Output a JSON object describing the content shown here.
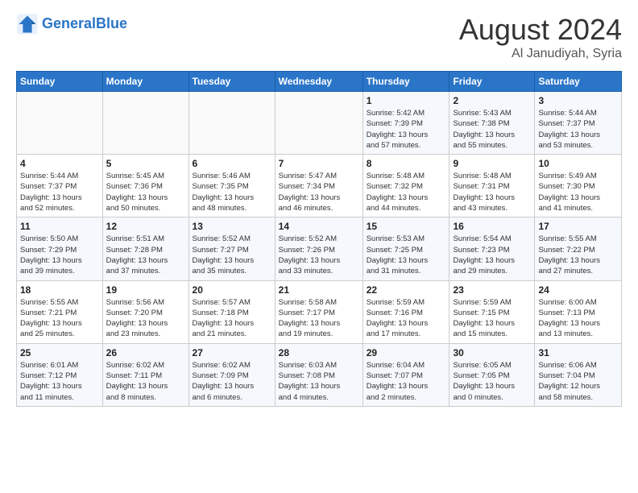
{
  "header": {
    "logo_line1": "General",
    "logo_line2": "Blue",
    "month": "August 2024",
    "location": "Al Janudiyah, Syria"
  },
  "weekdays": [
    "Sunday",
    "Monday",
    "Tuesday",
    "Wednesday",
    "Thursday",
    "Friday",
    "Saturday"
  ],
  "weeks": [
    [
      {
        "day": "",
        "info": ""
      },
      {
        "day": "",
        "info": ""
      },
      {
        "day": "",
        "info": ""
      },
      {
        "day": "",
        "info": ""
      },
      {
        "day": "1",
        "info": "Sunrise: 5:42 AM\nSunset: 7:39 PM\nDaylight: 13 hours\nand 57 minutes."
      },
      {
        "day": "2",
        "info": "Sunrise: 5:43 AM\nSunset: 7:38 PM\nDaylight: 13 hours\nand 55 minutes."
      },
      {
        "day": "3",
        "info": "Sunrise: 5:44 AM\nSunset: 7:37 PM\nDaylight: 13 hours\nand 53 minutes."
      }
    ],
    [
      {
        "day": "4",
        "info": "Sunrise: 5:44 AM\nSunset: 7:37 PM\nDaylight: 13 hours\nand 52 minutes."
      },
      {
        "day": "5",
        "info": "Sunrise: 5:45 AM\nSunset: 7:36 PM\nDaylight: 13 hours\nand 50 minutes."
      },
      {
        "day": "6",
        "info": "Sunrise: 5:46 AM\nSunset: 7:35 PM\nDaylight: 13 hours\nand 48 minutes."
      },
      {
        "day": "7",
        "info": "Sunrise: 5:47 AM\nSunset: 7:34 PM\nDaylight: 13 hours\nand 46 minutes."
      },
      {
        "day": "8",
        "info": "Sunrise: 5:48 AM\nSunset: 7:32 PM\nDaylight: 13 hours\nand 44 minutes."
      },
      {
        "day": "9",
        "info": "Sunrise: 5:48 AM\nSunset: 7:31 PM\nDaylight: 13 hours\nand 43 minutes."
      },
      {
        "day": "10",
        "info": "Sunrise: 5:49 AM\nSunset: 7:30 PM\nDaylight: 13 hours\nand 41 minutes."
      }
    ],
    [
      {
        "day": "11",
        "info": "Sunrise: 5:50 AM\nSunset: 7:29 PM\nDaylight: 13 hours\nand 39 minutes."
      },
      {
        "day": "12",
        "info": "Sunrise: 5:51 AM\nSunset: 7:28 PM\nDaylight: 13 hours\nand 37 minutes."
      },
      {
        "day": "13",
        "info": "Sunrise: 5:52 AM\nSunset: 7:27 PM\nDaylight: 13 hours\nand 35 minutes."
      },
      {
        "day": "14",
        "info": "Sunrise: 5:52 AM\nSunset: 7:26 PM\nDaylight: 13 hours\nand 33 minutes."
      },
      {
        "day": "15",
        "info": "Sunrise: 5:53 AM\nSunset: 7:25 PM\nDaylight: 13 hours\nand 31 minutes."
      },
      {
        "day": "16",
        "info": "Sunrise: 5:54 AM\nSunset: 7:23 PM\nDaylight: 13 hours\nand 29 minutes."
      },
      {
        "day": "17",
        "info": "Sunrise: 5:55 AM\nSunset: 7:22 PM\nDaylight: 13 hours\nand 27 minutes."
      }
    ],
    [
      {
        "day": "18",
        "info": "Sunrise: 5:55 AM\nSunset: 7:21 PM\nDaylight: 13 hours\nand 25 minutes."
      },
      {
        "day": "19",
        "info": "Sunrise: 5:56 AM\nSunset: 7:20 PM\nDaylight: 13 hours\nand 23 minutes."
      },
      {
        "day": "20",
        "info": "Sunrise: 5:57 AM\nSunset: 7:18 PM\nDaylight: 13 hours\nand 21 minutes."
      },
      {
        "day": "21",
        "info": "Sunrise: 5:58 AM\nSunset: 7:17 PM\nDaylight: 13 hours\nand 19 minutes."
      },
      {
        "day": "22",
        "info": "Sunrise: 5:59 AM\nSunset: 7:16 PM\nDaylight: 13 hours\nand 17 minutes."
      },
      {
        "day": "23",
        "info": "Sunrise: 5:59 AM\nSunset: 7:15 PM\nDaylight: 13 hours\nand 15 minutes."
      },
      {
        "day": "24",
        "info": "Sunrise: 6:00 AM\nSunset: 7:13 PM\nDaylight: 13 hours\nand 13 minutes."
      }
    ],
    [
      {
        "day": "25",
        "info": "Sunrise: 6:01 AM\nSunset: 7:12 PM\nDaylight: 13 hours\nand 11 minutes."
      },
      {
        "day": "26",
        "info": "Sunrise: 6:02 AM\nSunset: 7:11 PM\nDaylight: 13 hours\nand 8 minutes."
      },
      {
        "day": "27",
        "info": "Sunrise: 6:02 AM\nSunset: 7:09 PM\nDaylight: 13 hours\nand 6 minutes."
      },
      {
        "day": "28",
        "info": "Sunrise: 6:03 AM\nSunset: 7:08 PM\nDaylight: 13 hours\nand 4 minutes."
      },
      {
        "day": "29",
        "info": "Sunrise: 6:04 AM\nSunset: 7:07 PM\nDaylight: 13 hours\nand 2 minutes."
      },
      {
        "day": "30",
        "info": "Sunrise: 6:05 AM\nSunset: 7:05 PM\nDaylight: 13 hours\nand 0 minutes."
      },
      {
        "day": "31",
        "info": "Sunrise: 6:06 AM\nSunset: 7:04 PM\nDaylight: 12 hours\nand 58 minutes."
      }
    ]
  ]
}
